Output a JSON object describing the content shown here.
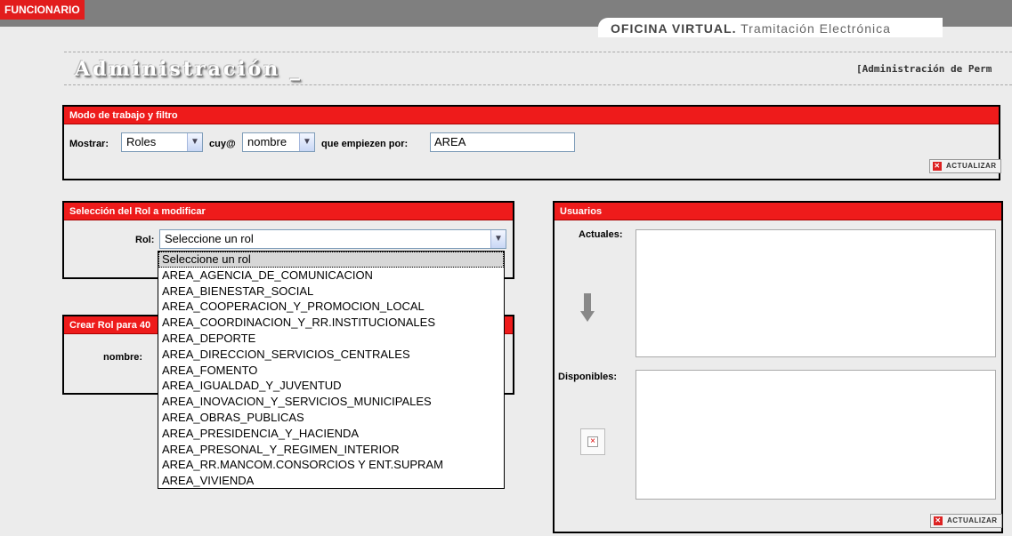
{
  "header": {
    "badge": "FUNCIONARIO",
    "office_strong": "OFICINA VIRTUAL.",
    "office_rest": " Tramitación Electrónica"
  },
  "page": {
    "title": "Administración _",
    "breadcrumb": "[Administración de Perm"
  },
  "filter_panel": {
    "title": "Modo de trabajo y filtro",
    "show_label": "Mostrar:",
    "show_value": "Roles",
    "whose_label": "cuy@",
    "whose_value": "nombre",
    "starts_label": "que empiezen por:",
    "starts_value": "AREA",
    "refresh": "ACTUALIZAR"
  },
  "role_panel": {
    "title": "Selección del Rol a modificar",
    "role_label": "Rol:",
    "role_value": "Seleccione un rol",
    "options": [
      "Seleccione un rol",
      "AREA_AGENCIA_DE_COMUNICACION",
      "AREA_BIENESTAR_SOCIAL",
      "AREA_COOPERACION_Y_PROMOCION_LOCAL",
      "AREA_COORDINACION_Y_RR.INSTITUCIONALES",
      "AREA_DEPORTE",
      "AREA_DIRECCION_SERVICIOS_CENTRALES",
      "AREA_FOMENTO",
      "AREA_IGUALDAD_Y_JUVENTUD",
      "AREA_INOVACION_Y_SERVICIOS_MUNICIPALES",
      "AREA_OBRAS_PUBLICAS",
      "AREA_PRESIDENCIA_Y_HACIENDA",
      "AREA_PRESONAL_Y_REGIMEN_INTERIOR",
      "AREA_RR.MANCOM.CONSORCIOS Y ENT.SUPRAM",
      "AREA_VIVIENDA"
    ]
  },
  "create_panel": {
    "title": "Crear Rol para 40",
    "name_label": "nombre:"
  },
  "users_panel": {
    "title": "Usuarios",
    "current_label": "Actuales:",
    "available_label": "Disponibles:",
    "refresh": "ACTUALIZAR"
  },
  "colors": {
    "accent_red": "#ee1b1b",
    "topbar_gray": "#7f7f7f"
  }
}
